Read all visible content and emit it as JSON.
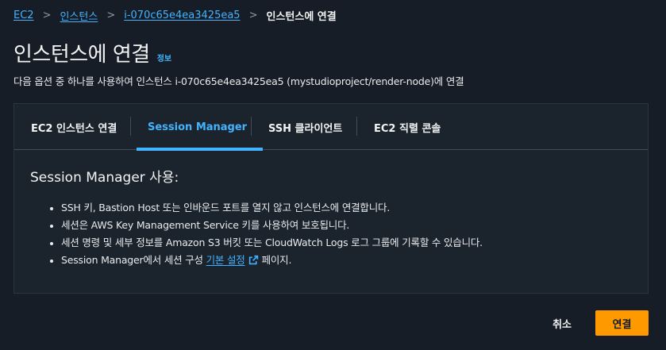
{
  "breadcrumb": {
    "items": [
      "EC2",
      "인스턴스",
      "i-070c65e4ea3425ea5"
    ],
    "current": "인스턴스에 연결",
    "separator": ">"
  },
  "header": {
    "title": "인스턴스에 연결",
    "info_label": "정보",
    "subtitle": "다음 옵션 중 하나를 사용하여 인스턴스 i-070c65e4ea3425ea5 (mystudioproject/render-node)에 연결"
  },
  "tabs": [
    {
      "label": "EC2 인스턴스 연결",
      "active": false
    },
    {
      "label": "Session Manager",
      "active": true
    },
    {
      "label": "SSH 클라이언트",
      "active": false
    },
    {
      "label": "EC2 직렬 콘솔",
      "active": false
    }
  ],
  "panel": {
    "heading": "Session Manager 사용:",
    "bullets": [
      "SSH 키, Bastion Host 또는 인바운드 포트를 열지 않고 인스턴스에 연결합니다.",
      "세션은 AWS Key Management Service 키를 사용하여 보호됩니다.",
      "세션 명령 및 세부 정보를 Amazon S3 버킷 또는 CloudWatch Logs 로그 그룹에 기록할 수 있습니다."
    ],
    "last_bullet": {
      "prefix": "Session Manager에서 세션 구성",
      "link": "기본 설정",
      "suffix": "페이지."
    }
  },
  "footer": {
    "cancel_label": "취소",
    "connect_label": "연결"
  },
  "colors": {
    "background": "#161d26",
    "container": "#1b232d",
    "link": "#42b4ff",
    "primary_button": "#ff9900",
    "text": "#f2f3f3"
  },
  "icons": {
    "breadcrumb_separator": "chevron-right-icon",
    "external_link": "external-link-icon"
  }
}
